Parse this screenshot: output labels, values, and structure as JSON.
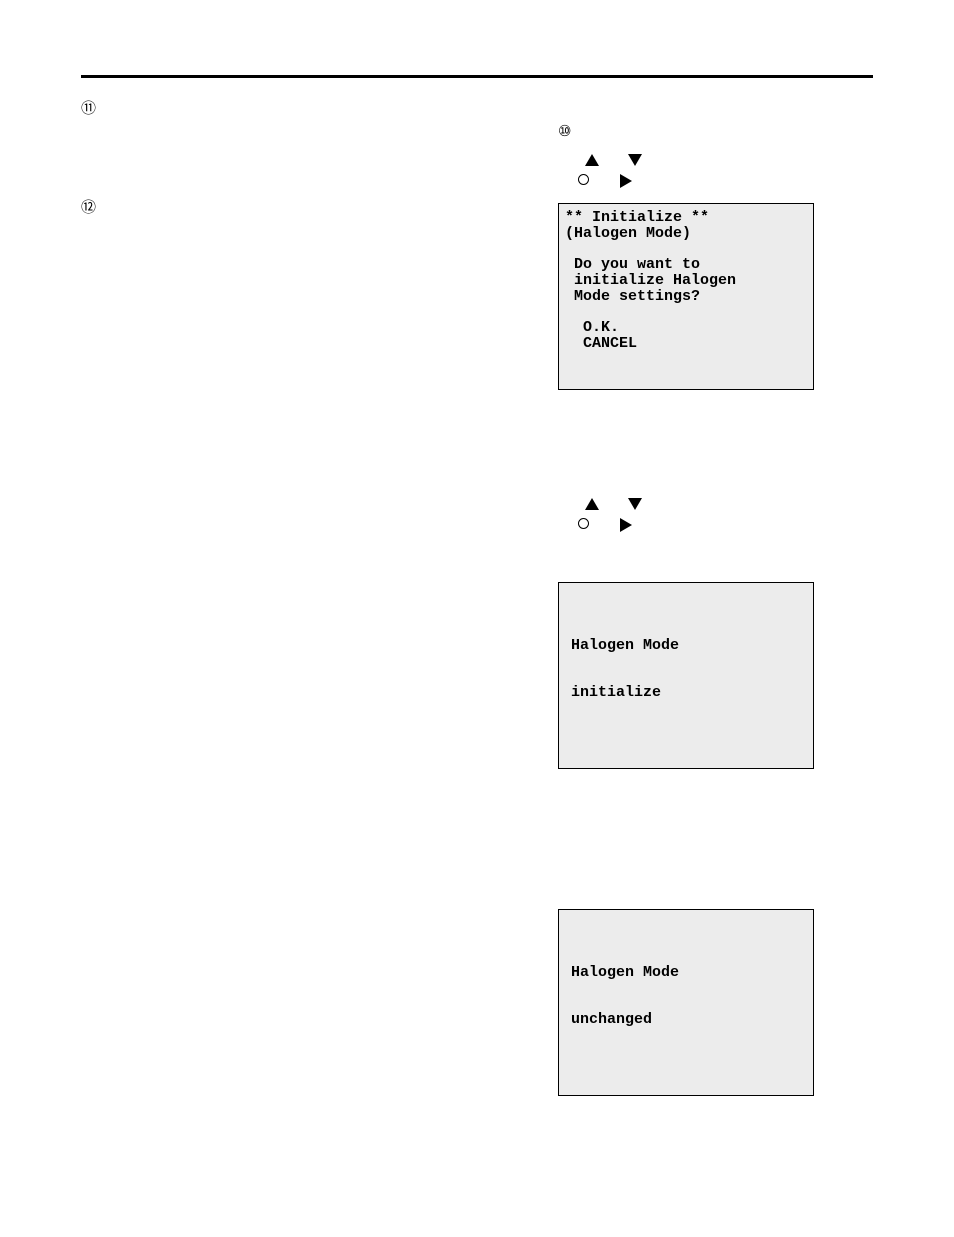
{
  "steps": {
    "s10": "⑩",
    "s11": "⑪",
    "s12": "⑫"
  },
  "panel1": {
    "l1": "** Initialize **",
    "l2": "(Halogen Mode)",
    "l3": " Do you want to",
    "l4": " initialize Halogen",
    "l5": " Mode settings?",
    "l6": "  O.K.",
    "l7": "  CANCEL"
  },
  "panel2": {
    "l1": "Halogen Mode",
    "l2": "initialize"
  },
  "panel3": {
    "l1": "Halogen Mode",
    "l2": "unchanged"
  }
}
